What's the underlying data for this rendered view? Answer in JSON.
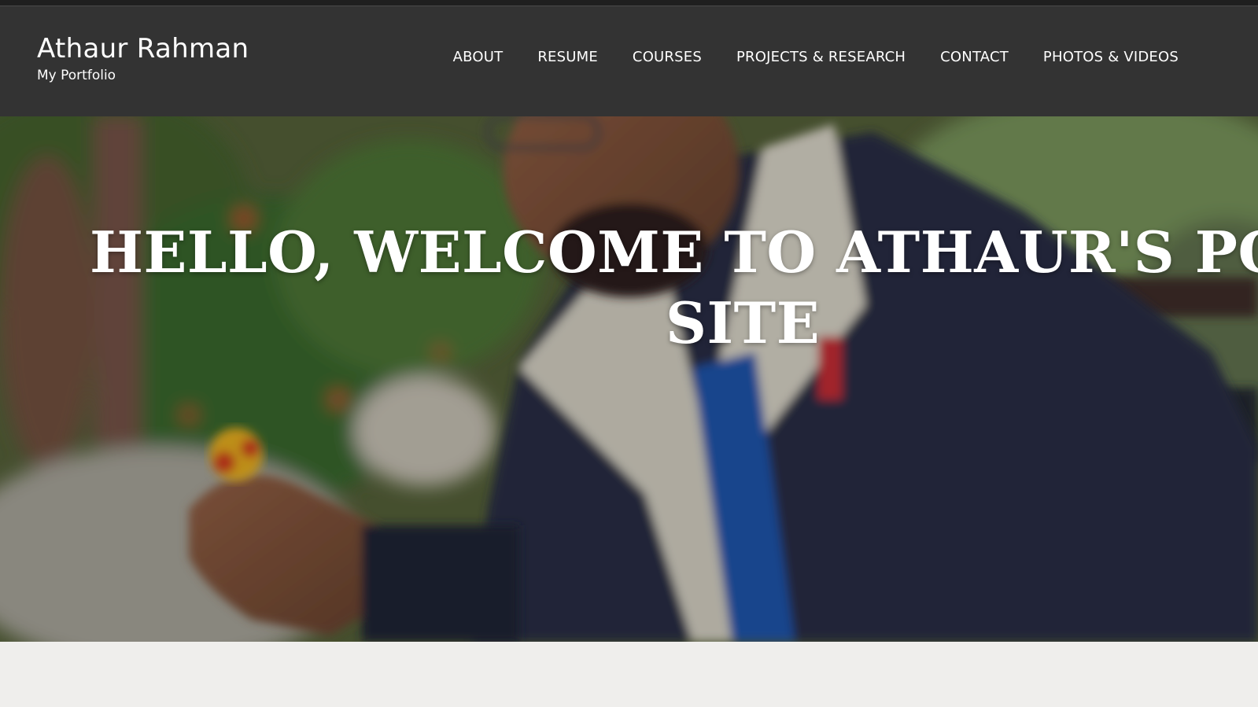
{
  "site": {
    "title": "Athaur Rahman",
    "subtitle": "My Portfolio"
  },
  "nav": {
    "items": [
      {
        "label": "ABOUT"
      },
      {
        "label": "RESUME"
      },
      {
        "label": "COURSES"
      },
      {
        "label": "PROJECTS & RESEARCH"
      },
      {
        "label": "CONTACT"
      },
      {
        "label": "PHOTOS & VIDEOS"
      }
    ]
  },
  "hero": {
    "heading_line1": "HELLO, WELCOME TO ATHAUR'S PORTFOLIO",
    "heading_line2": "SITE",
    "image": "portrait photo of man in navy jacket holding a flower"
  },
  "colors": {
    "header_bg": "#333333",
    "header_text": "#ffffff",
    "page_bg": "#efeeec"
  }
}
